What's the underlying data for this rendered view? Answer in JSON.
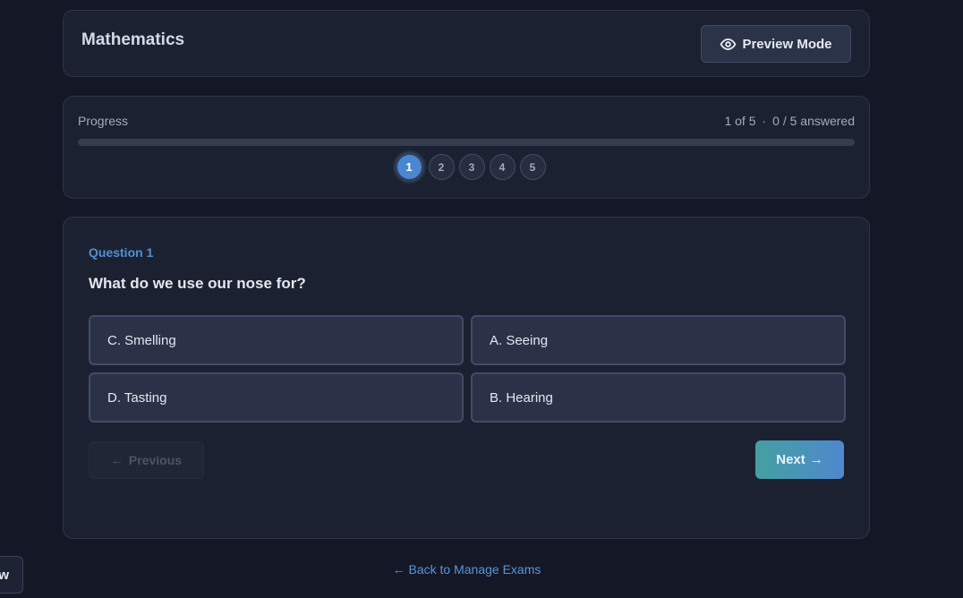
{
  "header": {
    "title": "Mathematics",
    "preview_label": "Preview Mode"
  },
  "progress": {
    "label": "Progress",
    "position_text": "1 of 5",
    "separator": "·",
    "answered_text": "0 / 5 answered",
    "fraction_answered": 0,
    "steps": [
      "1",
      "2",
      "3",
      "4",
      "5"
    ],
    "active_step": 1
  },
  "question": {
    "number_label": "Question 1",
    "text": "What do we use our nose for?",
    "options": [
      "C. Smelling",
      "A. Seeing",
      "D. Tasting",
      "B. Hearing"
    ]
  },
  "navigation": {
    "previous_label": "Previous",
    "previous_arrow": "←",
    "next_label": "Next",
    "next_arrow": "→"
  },
  "footer": {
    "back_link": "← Back to Manage Exams"
  },
  "side_tab": {
    "label": "w"
  },
  "colors": {
    "background": "#141826",
    "card": "#1c2132",
    "accent": "#4a87d0",
    "next_gradient_start": "#44a0a0",
    "next_gradient_end": "#4f88cf"
  }
}
